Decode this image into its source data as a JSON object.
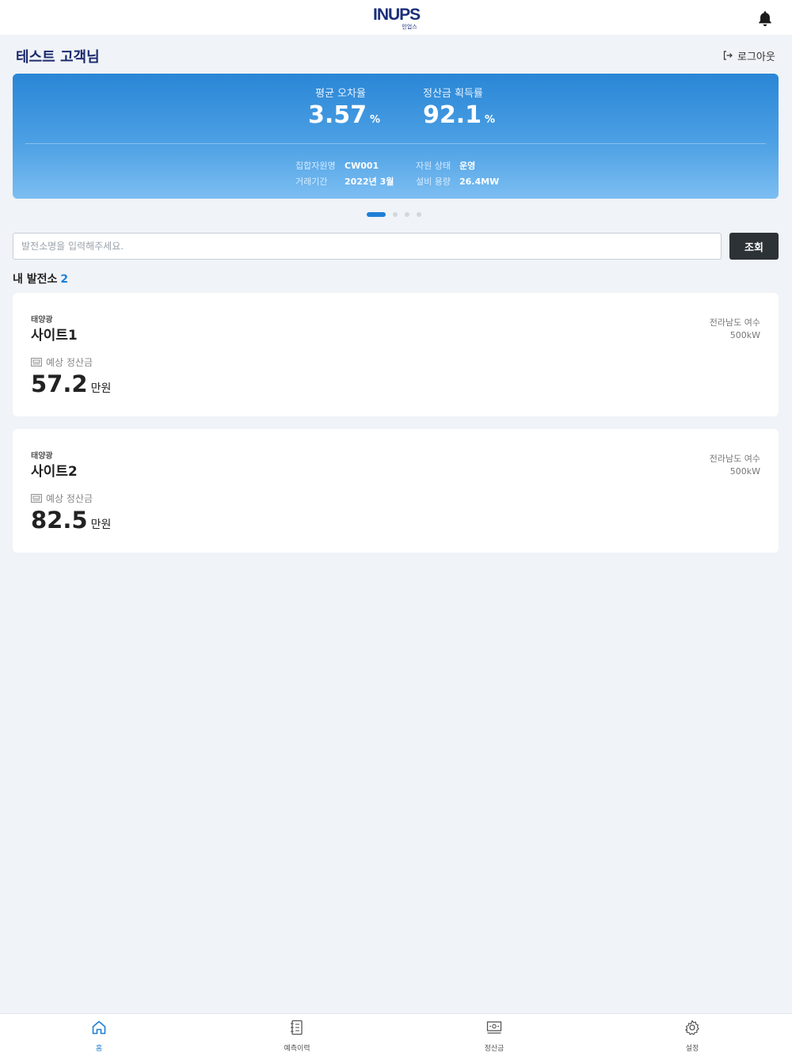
{
  "header": {
    "logo_text": "INUPS",
    "logo_sub": "인업스",
    "bell_icon": "bell-icon"
  },
  "user": {
    "greeting": "테스트 고객님",
    "logout_label": "로그아웃",
    "logout_icon": "logout-icon"
  },
  "summary": {
    "error_rate_label": "평균 오차율",
    "error_rate_value": "3.57",
    "error_rate_unit": "%",
    "settlement_rate_label": "정산금 획득률",
    "settlement_rate_value": "92.1",
    "settlement_rate_unit": "%",
    "resource_name_label": "집합자원명",
    "resource_name_value": "CW001",
    "trade_period_label": "거래기간",
    "trade_period_value": "2022년 3월",
    "resource_status_label": "자원 상태",
    "resource_status_value": "운영",
    "capacity_label": "설비 용량",
    "capacity_value": "26.4MW"
  },
  "carousel": {
    "pages": 4,
    "active_index": 0
  },
  "search": {
    "placeholder": "발전소명을 입력해주세요.",
    "value": "",
    "button_label": "조회"
  },
  "plants_section": {
    "title": "내 발전소",
    "count": "2"
  },
  "plants": [
    {
      "type": "태양광",
      "name": "사이트1",
      "location": "전라남도 여수",
      "capacity": "500kW",
      "estimate_label": "예상 정산금",
      "amount": "57.2",
      "amount_unit": "만원"
    },
    {
      "type": "태양광",
      "name": "사이트2",
      "location": "전라남도 여수",
      "capacity": "500kW",
      "estimate_label": "예상 정산금",
      "amount": "82.5",
      "amount_unit": "만원"
    }
  ],
  "bottom_nav": {
    "active": "home",
    "items": [
      {
        "label": "홈",
        "icon": "home-icon"
      },
      {
        "label": "예측이력",
        "icon": "notebook-icon"
      },
      {
        "label": "정산금",
        "icon": "money-icon"
      },
      {
        "label": "설정",
        "icon": "gear-icon"
      }
    ]
  },
  "colors": {
    "accent": "#1f7fd6",
    "title": "#1c2a6e",
    "dark_button": "#2d3236"
  }
}
